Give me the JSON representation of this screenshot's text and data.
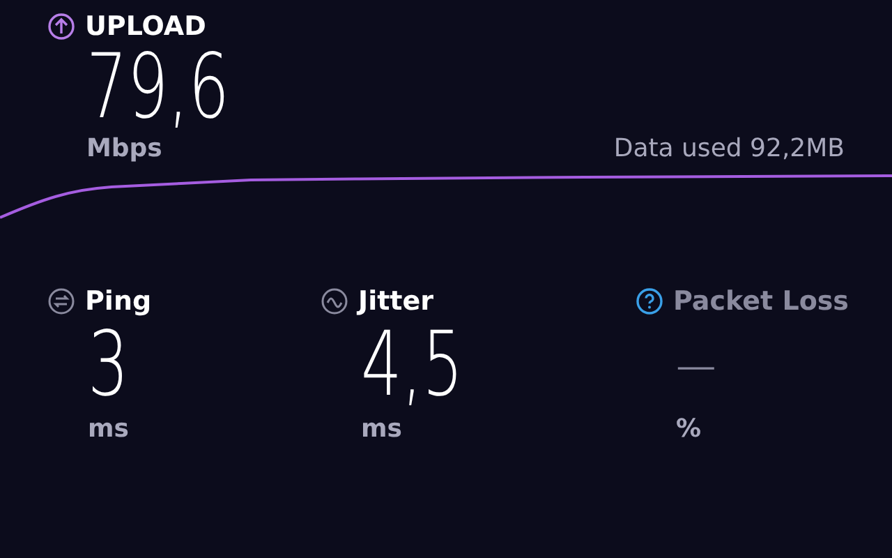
{
  "upload": {
    "label": "UPLOAD",
    "value": "79,6",
    "unit": "Mbps"
  },
  "data_used": "Data used 92,2MB",
  "metrics": [
    {
      "kind": "ping",
      "label": "Ping",
      "value": "3",
      "unit": "ms",
      "disabled": false
    },
    {
      "kind": "jitter",
      "label": "Jitter",
      "value": "4,5",
      "unit": "ms",
      "disabled": false
    },
    {
      "kind": "loss",
      "label": "Packet Loss",
      "value": "—",
      "unit": "%",
      "disabled": true
    }
  ]
}
